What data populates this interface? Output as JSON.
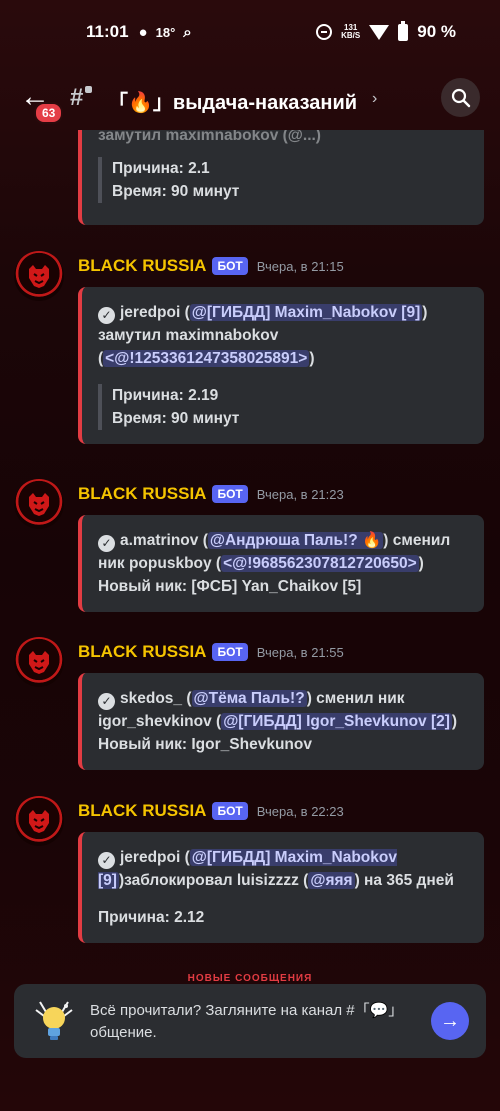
{
  "status_bar": {
    "time": "11:01",
    "temperature": "18°",
    "network_speed_value": "131",
    "network_speed_unit": "KB/S",
    "battery": "90 %"
  },
  "header": {
    "unread_count": "63",
    "channel_name": "「🔥」выдача-наказаний",
    "icons": [
      "back-arrow-icon",
      "hash-lock-icon",
      "chevron-right-icon",
      "search-icon"
    ]
  },
  "messages": [
    {
      "partial": true,
      "top_fragment": "замутил maximnabokov (@...)",
      "reason": "Причина: 2.1",
      "duration": "Время: 90 минут"
    },
    {
      "author": "BLACK RUSSIA",
      "tag": "БОТ",
      "time": "Вчера, в 21:15",
      "actor": "jeredpoi (",
      "actor_mention": "@[ГИБДД] Maxim_Nabokov [9]",
      "action": ") замутил maximnabokov (",
      "target_mention": "<@!1253361247358025891>",
      "action_end": ")",
      "reason": "Причина: 2.19",
      "duration": "Время: 90 минут"
    },
    {
      "author": "BLACK RUSSIA",
      "tag": "БОТ",
      "time": "Вчера, в 21:23",
      "actor": "a.matrinov (",
      "actor_mention": "@Андрюша Паль!? 🔥",
      "action": ") сменил ник  popuskboy (",
      "target_mention": "<@!968562307812720650>",
      "action_end": ")",
      "new_nick": "Новый ник: [ФСБ] Yan_Chaikov [5]"
    },
    {
      "author": "BLACK RUSSIA",
      "tag": "БОТ",
      "time": "Вчера, в 21:55",
      "actor": "skedos_ (",
      "actor_mention": "@Тёма Паль!?",
      "action": ") сменил ник igor_shevkinov (",
      "target_mention": "@[ГИБДД] Igor_Shevkunov [2]",
      "action_end": ")",
      "new_nick": "Новый ник: Igor_Shevkunov"
    },
    {
      "author": "BLACK RUSSIA",
      "tag": "БОТ",
      "time": "Вчера, в 22:23",
      "actor": "jeredpoi (",
      "actor_mention": "@[ГИБДД] Maxim_Nabokov [9]",
      "action": ")заблокировал luisizzzz (",
      "target_mention": "@яяя",
      "action_end": ") на 365 дней",
      "reason": "Причина: 2.12"
    }
  ],
  "new_messages_divider": "НОВЫЕ СООБЩЕНИЯ",
  "bottom_prompt": {
    "text": "Всё прочитали? Загляните на канал #「💬」общение.",
    "button_icon": "arrow-right-icon"
  },
  "colors": {
    "accent": "#5865f2",
    "embed_border": "#e23c43",
    "author": "#f5c400"
  }
}
